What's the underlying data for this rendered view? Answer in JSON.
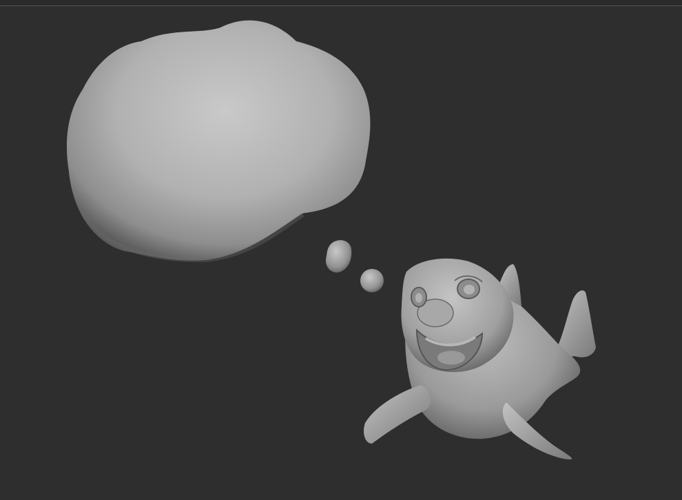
{
  "viewport": {
    "background_color": "#2e2e2e",
    "edge_line_color": "#555555"
  },
  "scene": {
    "objects": [
      {
        "icon": "thought-cloud",
        "material_color": "#b5b5b5"
      },
      {
        "icon": "bubble-large",
        "material_color": "#9a9a9a"
      },
      {
        "icon": "bubble-small",
        "material_color": "#a8a8a8"
      },
      {
        "icon": "dolphin-character",
        "material_color": "#a9a9a9"
      }
    ]
  }
}
